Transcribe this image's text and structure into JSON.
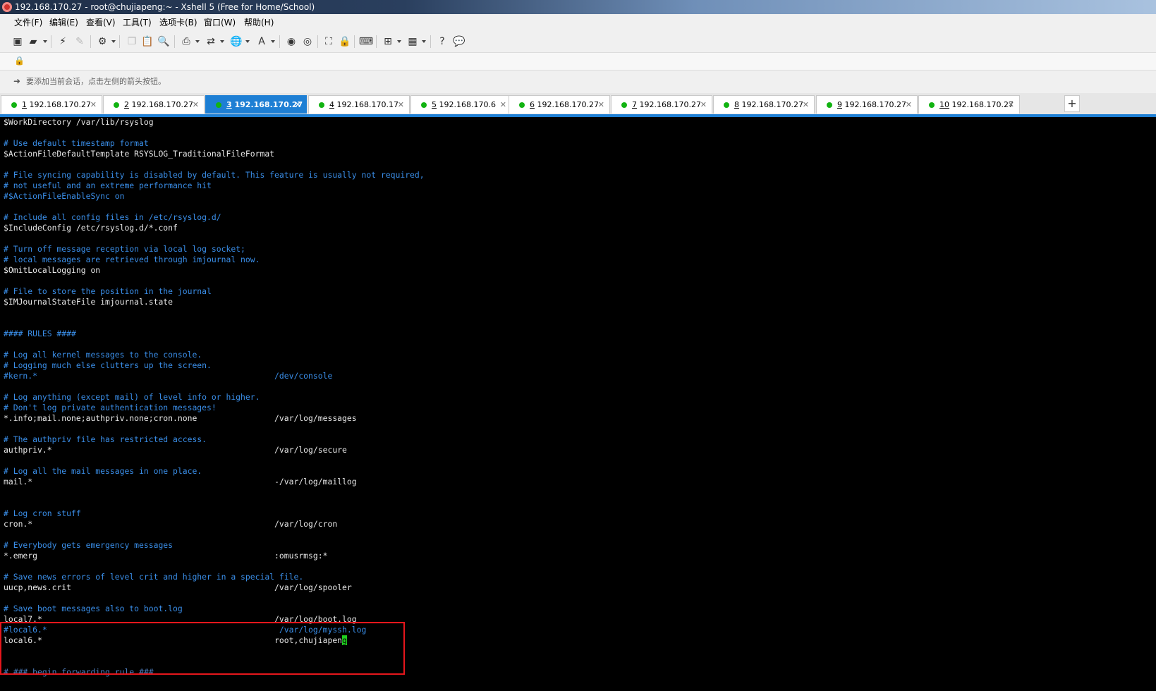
{
  "window": {
    "title": "192.168.170.27 - root@chujiapeng:~ - Xshell 5 (Free for Home/School)"
  },
  "menu": [
    {
      "label": "文件(F)"
    },
    {
      "label": "编辑(E)"
    },
    {
      "label": "查看(V)"
    },
    {
      "label": "工具(T)"
    },
    {
      "label": "选项卡(B)"
    },
    {
      "label": "窗口(W)"
    },
    {
      "label": "帮助(H)"
    }
  ],
  "hint": {
    "text": "要添加当前会话，点击左侧的箭头按钮。"
  },
  "tabs": [
    {
      "num": "1",
      "host": " 192.168.170.27",
      "active": false
    },
    {
      "num": "2",
      "host": " 192.168.170.27",
      "active": false
    },
    {
      "num": "3",
      "host": " 192.168.170.27",
      "active": true
    },
    {
      "num": "4",
      "host": " 192.168.170.17",
      "active": false
    },
    {
      "num": "5",
      "host": " 192.168.170.6",
      "active": false
    },
    {
      "num": "6",
      "host": " 192.168.170.27",
      "active": false
    },
    {
      "num": "7",
      "host": " 192.168.170.27",
      "active": false
    },
    {
      "num": "8",
      "host": " 192.168.170.27",
      "active": false
    },
    {
      "num": "9",
      "host": " 192.168.170.27",
      "active": false
    },
    {
      "num": "10",
      "host": " 192.168.170.27",
      "active": false
    }
  ],
  "tab_add_label": "+",
  "terminal": {
    "lines": [
      {
        "text": "$WorkDirectory /var/lib/rsyslog",
        "style": "txt"
      },
      {
        "text": "",
        "style": "txt"
      },
      {
        "text": "# Use default timestamp format",
        "style": "cmt"
      },
      {
        "text": "$ActionFileDefaultTemplate RSYSLOG_TraditionalFileFormat",
        "style": "txt"
      },
      {
        "text": "",
        "style": "txt"
      },
      {
        "text": "# File syncing capability is disabled by default. This feature is usually not required,",
        "style": "cmt"
      },
      {
        "text": "# not useful and an extreme performance hit",
        "style": "cmt"
      },
      {
        "text": "#$ActionFileEnableSync on",
        "style": "cmt"
      },
      {
        "text": "",
        "style": "txt"
      },
      {
        "text": "# Include all config files in /etc/rsyslog.d/",
        "style": "cmt"
      },
      {
        "text": "$IncludeConfig /etc/rsyslog.d/*.conf",
        "style": "txt"
      },
      {
        "text": "",
        "style": "txt"
      },
      {
        "text": "# Turn off message reception via local log socket;",
        "style": "cmt"
      },
      {
        "text": "# local messages are retrieved through imjournal now.",
        "style": "cmt"
      },
      {
        "text": "$OmitLocalLogging on",
        "style": "txt"
      },
      {
        "text": "",
        "style": "txt"
      },
      {
        "text": "# File to store the position in the journal",
        "style": "cmt"
      },
      {
        "text": "$IMJournalStateFile imjournal.state",
        "style": "txt"
      },
      {
        "text": "",
        "style": "txt"
      },
      {
        "text": "",
        "style": "txt"
      },
      {
        "text": "#### RULES ####",
        "style": "cmt"
      },
      {
        "text": "",
        "style": "txt"
      },
      {
        "text": "# Log all kernel messages to the console.",
        "style": "cmt"
      },
      {
        "text": "# Logging much else clutters up the screen.",
        "style": "cmt"
      },
      {
        "text": "#kern.*                                                 /dev/console",
        "style": "cmt"
      },
      {
        "text": "",
        "style": "txt"
      },
      {
        "text": "# Log anything (except mail) of level info or higher.",
        "style": "cmt"
      },
      {
        "text": "# Don't log private authentication messages!",
        "style": "cmt"
      },
      {
        "text": "*.info;mail.none;authpriv.none;cron.none                /var/log/messages",
        "style": "txt"
      },
      {
        "text": "",
        "style": "txt"
      },
      {
        "text": "# The authpriv file has restricted access.",
        "style": "cmt"
      },
      {
        "text": "authpriv.*                                              /var/log/secure",
        "style": "txt"
      },
      {
        "text": "",
        "style": "txt"
      },
      {
        "text": "# Log all the mail messages in one place.",
        "style": "cmt"
      },
      {
        "text": "mail.*                                                  -/var/log/maillog",
        "style": "txt"
      },
      {
        "text": "",
        "style": "txt"
      },
      {
        "text": "",
        "style": "txt"
      },
      {
        "text": "# Log cron stuff",
        "style": "cmt"
      },
      {
        "text": "cron.*                                                  /var/log/cron",
        "style": "txt"
      },
      {
        "text": "",
        "style": "txt"
      },
      {
        "text": "# Everybody gets emergency messages",
        "style": "cmt"
      },
      {
        "text": "*.emerg                                                 :omusrmsg:*",
        "style": "txt"
      },
      {
        "text": "",
        "style": "txt"
      },
      {
        "text": "# Save news errors of level crit and higher in a special file.",
        "style": "cmt"
      },
      {
        "text": "uucp,news.crit                                          /var/log/spooler",
        "style": "txt"
      },
      {
        "text": "",
        "style": "txt"
      },
      {
        "text": "# Save boot messages also to boot.log",
        "style": "cmt"
      },
      {
        "text": "local7.*                                                /var/log/boot.log",
        "style": "txt"
      },
      {
        "text": "#local6.*                                                /var/log/myssh.log",
        "style": "cmt"
      },
      {
        "text": "local6.*                                                root,chujiapen",
        "style": "txt",
        "cursor": "g"
      },
      {
        "text": "",
        "style": "txt"
      },
      {
        "text": "",
        "style": "txt"
      },
      {
        "text": "# ### begin forwarding rule ###",
        "style": "faint"
      }
    ]
  }
}
